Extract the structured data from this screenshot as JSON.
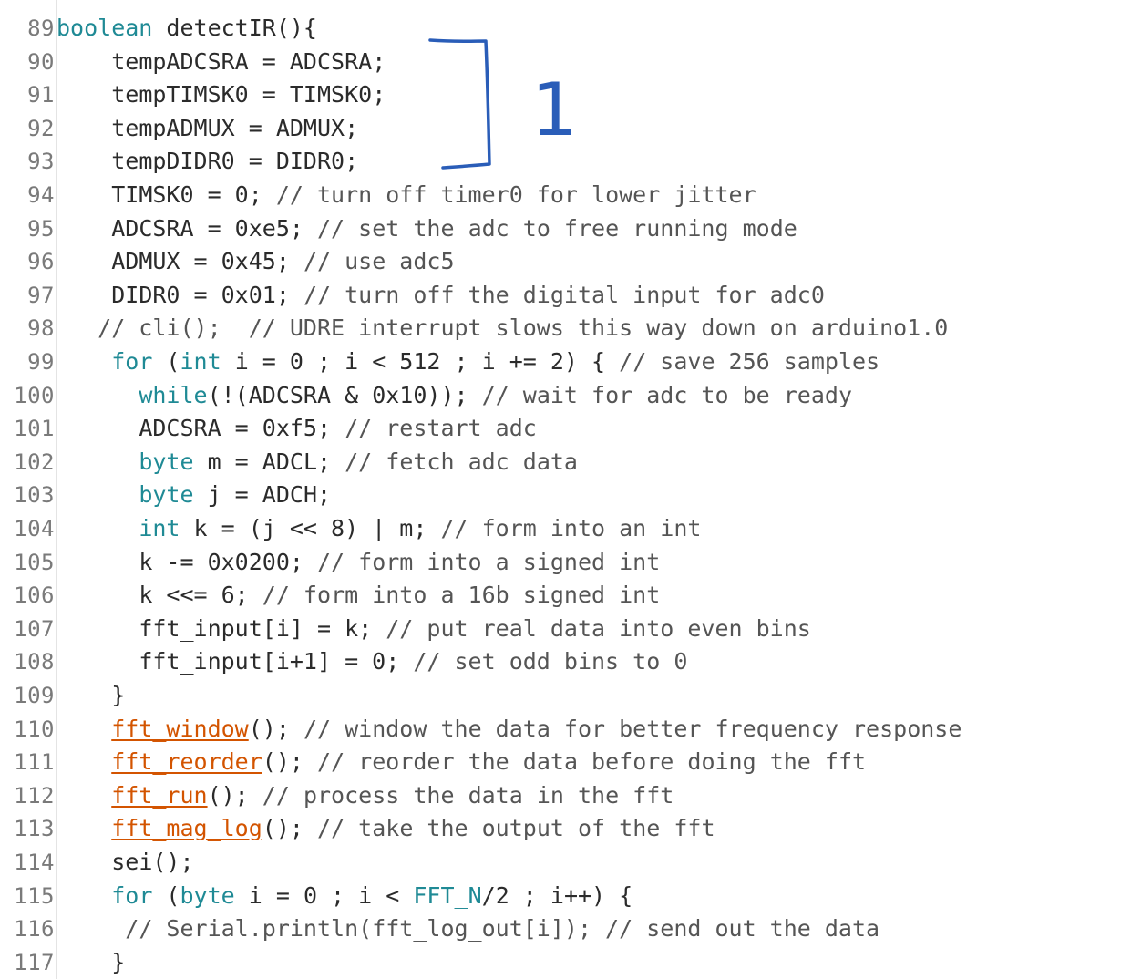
{
  "editor": {
    "lines": [
      {
        "num": "89",
        "indent": "",
        "segs": [
          [
            "kw",
            "boolean"
          ],
          [
            "txt",
            " detectIR(){"
          ]
        ]
      },
      {
        "num": "90",
        "indent": "    ",
        "segs": [
          [
            "txt",
            "tempADCSRA = ADCSRA;"
          ]
        ]
      },
      {
        "num": "91",
        "indent": "    ",
        "segs": [
          [
            "txt",
            "tempTIMSK0 = TIMSK0;"
          ]
        ]
      },
      {
        "num": "92",
        "indent": "    ",
        "segs": [
          [
            "txt",
            "tempADMUX = ADMUX;"
          ]
        ]
      },
      {
        "num": "93",
        "indent": "    ",
        "segs": [
          [
            "txt",
            "tempDIDR0 = DIDR0;"
          ]
        ]
      },
      {
        "num": "94",
        "indent": "    ",
        "segs": [
          [
            "txt",
            "TIMSK0 = 0; "
          ],
          [
            "cm",
            "// turn off timer0 for lower jitter"
          ]
        ]
      },
      {
        "num": "95",
        "indent": "    ",
        "segs": [
          [
            "txt",
            "ADCSRA = 0xe5; "
          ],
          [
            "cm",
            "// set the adc to free running mode"
          ]
        ]
      },
      {
        "num": "96",
        "indent": "    ",
        "segs": [
          [
            "txt",
            "ADMUX = 0x45; "
          ],
          [
            "cm",
            "// use adc5"
          ]
        ]
      },
      {
        "num": "97",
        "indent": "    ",
        "segs": [
          [
            "txt",
            "DIDR0 = 0x01; "
          ],
          [
            "cm",
            "// turn off the digital input for adc0"
          ]
        ]
      },
      {
        "num": "98",
        "indent": "   ",
        "segs": [
          [
            "cm",
            "// cli();  // UDRE interrupt slows this way down on arduino1.0"
          ]
        ]
      },
      {
        "num": "99",
        "indent": "    ",
        "segs": [
          [
            "kw",
            "for"
          ],
          [
            "txt",
            " ("
          ],
          [
            "ty",
            "int"
          ],
          [
            "txt",
            " i = 0 ; i < 512 ; i += 2) { "
          ],
          [
            "cm",
            "// save 256 samples"
          ]
        ]
      },
      {
        "num": "100",
        "indent": "      ",
        "segs": [
          [
            "kw",
            "while"
          ],
          [
            "txt",
            "(!(ADCSRA & 0x10)); "
          ],
          [
            "cm",
            "// wait for adc to be ready"
          ]
        ]
      },
      {
        "num": "101",
        "indent": "      ",
        "segs": [
          [
            "txt",
            "ADCSRA = 0xf5; "
          ],
          [
            "cm",
            "// restart adc"
          ]
        ]
      },
      {
        "num": "102",
        "indent": "      ",
        "segs": [
          [
            "ty",
            "byte"
          ],
          [
            "txt",
            " m = ADCL; "
          ],
          [
            "cm",
            "// fetch adc data"
          ]
        ]
      },
      {
        "num": "103",
        "indent": "      ",
        "segs": [
          [
            "ty",
            "byte"
          ],
          [
            "txt",
            " j = ADCH;"
          ]
        ]
      },
      {
        "num": "104",
        "indent": "      ",
        "segs": [
          [
            "ty",
            "int"
          ],
          [
            "txt",
            " k = (j << 8) | m; "
          ],
          [
            "cm",
            "// form into an int"
          ]
        ]
      },
      {
        "num": "105",
        "indent": "      ",
        "segs": [
          [
            "txt",
            "k -= 0x0200; "
          ],
          [
            "cm",
            "// form into a signed int"
          ]
        ]
      },
      {
        "num": "106",
        "indent": "      ",
        "segs": [
          [
            "txt",
            "k <<= 6; "
          ],
          [
            "cm",
            "// form into a 16b signed int"
          ]
        ]
      },
      {
        "num": "107",
        "indent": "      ",
        "segs": [
          [
            "txt",
            "fft_input[i] = k; "
          ],
          [
            "cm",
            "// put real data into even bins"
          ]
        ]
      },
      {
        "num": "108",
        "indent": "      ",
        "segs": [
          [
            "txt",
            "fft_input[i+1] = 0; "
          ],
          [
            "cm",
            "// set odd bins to 0"
          ]
        ]
      },
      {
        "num": "109",
        "indent": "    ",
        "segs": [
          [
            "txt",
            "}"
          ]
        ]
      },
      {
        "num": "110",
        "indent": "    ",
        "segs": [
          [
            "fn",
            "fft_window"
          ],
          [
            "txt",
            "(); "
          ],
          [
            "cm",
            "// window the data for better frequency response"
          ]
        ]
      },
      {
        "num": "111",
        "indent": "    ",
        "segs": [
          [
            "fn",
            "fft_reorder"
          ],
          [
            "txt",
            "(); "
          ],
          [
            "cm",
            "// reorder the data before doing the fft"
          ]
        ]
      },
      {
        "num": "112",
        "indent": "    ",
        "segs": [
          [
            "fn",
            "fft_run"
          ],
          [
            "txt",
            "(); "
          ],
          [
            "cm",
            "// process the data in the fft"
          ]
        ]
      },
      {
        "num": "113",
        "indent": "    ",
        "segs": [
          [
            "fn",
            "fft_mag_log"
          ],
          [
            "txt",
            "(); "
          ],
          [
            "cm",
            "// take the output of the fft"
          ]
        ]
      },
      {
        "num": "114",
        "indent": "    ",
        "segs": [
          [
            "txt",
            "sei();"
          ]
        ]
      },
      {
        "num": "115",
        "indent": "    ",
        "segs": [
          [
            "kw",
            "for"
          ],
          [
            "txt",
            " ("
          ],
          [
            "ty",
            "byte"
          ],
          [
            "txt",
            " i = 0 ; i < "
          ],
          [
            "const",
            "FFT_N"
          ],
          [
            "txt",
            "/2 ; i++) {"
          ]
        ]
      },
      {
        "num": "116",
        "indent": "     ",
        "segs": [
          [
            "cm",
            "// Serial.println(fft_log_out[i]); // send out the data"
          ]
        ]
      },
      {
        "num": "117",
        "indent": "    ",
        "segs": [
          [
            "txt",
            "}"
          ]
        ]
      }
    ]
  },
  "annotation": {
    "label": "1",
    "ink_color": "#2a5db8"
  }
}
